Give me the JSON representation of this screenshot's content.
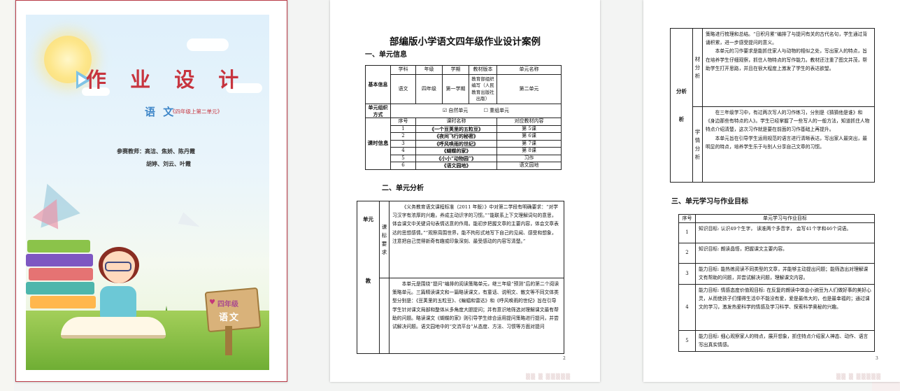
{
  "cover": {
    "title": "作 业 设 计",
    "subject": "语 文",
    "subject_sub": "《四年级上第二单元》",
    "teachers_line1": "参赛教师：高洁、焦娇、陈丹霞",
    "teachers_line2": "胡婷、刘云、叶霞",
    "sign_grade": "四年级",
    "sign_subject": "语文"
  },
  "page2": {
    "title": "部编版小学语文四年级作业设计案例",
    "section1": "一、单元信息",
    "basic_info_label": "基本信息",
    "headers": [
      "学科",
      "年级",
      "学期",
      "教材版本",
      "单元名称"
    ],
    "values": [
      "语文",
      "四年级",
      "第一学期",
      "教育部组织编写（人民教育出版社出版）",
      "第二单元"
    ],
    "org_label": "单元组织方式",
    "org_option1": "☑ 自然单元",
    "org_option2": "☐ 重组单元",
    "lesson_label": "课时信息",
    "lesson_headers": [
      "序号",
      "课时名称",
      "对应教材内容"
    ],
    "lessons": [
      {
        "no": "1",
        "name": "《一个豆荚里的五粒豆》",
        "content": "第 5课"
      },
      {
        "no": "2",
        "name": "《夜间飞行的秘密》",
        "content": "第 6课"
      },
      {
        "no": "3",
        "name": "《呼风唤雨的世纪》",
        "content": "第 7课"
      },
      {
        "no": "4",
        "name": "《蝴蝶的家》",
        "content": "第 8课"
      },
      {
        "no": "5",
        "name": "《小小“动物园”》",
        "content": "习作"
      },
      {
        "no": "6",
        "name": "《语文园地》",
        "content": "语文园地"
      }
    ],
    "section2": "二、单元分析",
    "unit_label": "单元",
    "teach_label": "教",
    "req_label": "课标要求",
    "req_text": "《义务教育语文课程标准（2011 年版）》中对第二学段有明确要求：“对学习汉字有浓厚的兴趣，养成主动识字的习惯。”“能联系上下文理解词句的意思，体会课文中关键词句表情达意的作用。能初步把握文章的主要内容，体会文章表达的思想感情。”“观察周围世界，能不拘形式地写下自己的见闻、感受和想象，注意把自己觉得新奇有趣或印象深刻、最受感动的内容写清楚。”",
    "material_text": "本单元是围绕“提问”编排的阅读策略单元，继三年级“预测”后的第二个阅读策略单元。三篇精读课文和一篇略读课文，有童话、说明文、散文等不同文体类型分别是：《豆荚里的五粒豆》、《蝙蝠和雷达》和《呼风唤雨的世纪》旨在引导学生针对课文局部和整体从多角度大胆提问；并有意识地筛选对理解课文最有帮助的问题。略读课文《蝴蝶的家》则引导学生综合运用提问策略进行提问，并尝试解决问题。语文园地中的“交流平台”从态度、方法、习惯等方面对提问",
    "page_number": "2"
  },
  "page3": {
    "analysis_label": "分析",
    "analysis_label2": "析",
    "material_label": "材分析",
    "material_text_1": "策略进行梳理和总结。“日积月累”编排了与提问有关的古代名句，学生通过背诵积累，进一步感受提问的意义。",
    "material_text_2": "本单元的习作要求是能抓住家人与动物的相似之处，写出家人的特点，旨在培养学生仔细观察，抓住人物特点的写作能力。教材还注重了图文并茂，帮助学生打开思路，并且在很大程度上激发了学生的表达欲望。",
    "student_label": "学情分析",
    "student_text_1": "在三年级学习中，有过两次写人的习作练习，分别是《猜猜他是谁》和《身边那些有特点的人》。学生已经掌握了一些写人的一般方法，知道抓住人物特点介绍清楚，这次习作就是要在前面的习作基础上再提升。",
    "student_text_2": "本单元旨在引导学生运用规范的语言进行清晰表达，写出家人最突出，最明显的特点，培养学生乐于与别人分享自己文章的习惯。",
    "section3": "三、单元学习与作业目标",
    "goal_headers": [
      "序号",
      "单元学习与作业目标"
    ],
    "goals": [
      {
        "no": "1",
        "text": "知识目标: 认识49个生字， 读准两个多音字， 会写41个字和46个词语。"
      },
      {
        "no": "2",
        "text": "知识目标: 朗读晶悟，把握课文主要内容。"
      },
      {
        "no": "3",
        "text": "能力目标: 能热练阅读不同类型的文章，并能够主动提出问题；能筛选出对理解课文有帮助的问题，并尝试解决问题，理解课文内容。"
      },
      {
        "no": "4",
        "text": "能力目标: 情感态度价值观目标: 在反复的朗读中体会小豌豆为人们做好事的美好心灵，从而使孩子们懂得生活中不能没有爱，爱是最伟大的，也是最幸福的；通过课文的学习，激发热爱科学的情感及学习科学、探索科学奥秘的兴趣。"
      },
      {
        "no": "5",
        "text": "能力目标: 细心观察家人的特点，展开想象，抓住特点介绍家人神态、动作、语言写出真实情感。"
      }
    ],
    "page_number": "3"
  }
}
